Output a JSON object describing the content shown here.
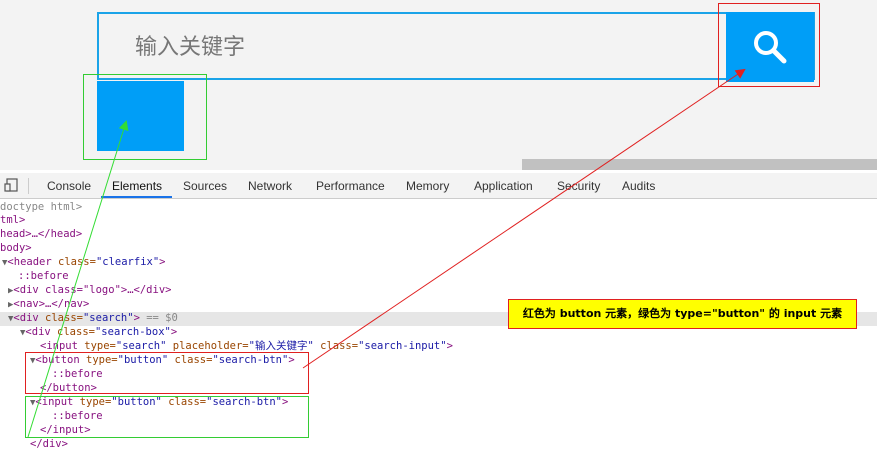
{
  "preview": {
    "search_placeholder": "输入关键字",
    "accent_color": "#009ef7",
    "icon": "search-icon"
  },
  "devtools": {
    "tabs": [
      "Console",
      "Elements",
      "Sources",
      "Network",
      "Performance",
      "Memory",
      "Application",
      "Security",
      "Audits"
    ],
    "active_tab": "Elements"
  },
  "dom": {
    "doctype": "doctype html>",
    "html_open": "tml>",
    "head": "head>…</head>",
    "body": "body>",
    "header_tag": "<header",
    "header_attr": " class=",
    "header_val": "\"clearfix\"",
    "header_close": ">",
    "before1": "::before",
    "logo": "<div class=\"logo\">…</div>",
    "nav": "<nav>…</nav>",
    "search_div_tag": "<div",
    "search_div_attr": " class=",
    "search_div_val": "\"search\"",
    "search_div_close": ">",
    "search_div_eq": " == $0",
    "search_box_tag": "<div",
    "search_box_attr": " class=",
    "search_box_val": "\"search-box\"",
    "search_box_close": ">",
    "input_tag": "<input",
    "input_type_attr": " type=",
    "input_type_val": "\"search\"",
    "input_ph_attr": " placeholder=",
    "input_ph_val": "\"输入关键字\"",
    "input_class_attr": " class=",
    "input_class_val": "\"search-input\"",
    "input_close": ">",
    "button_tag": "<button",
    "button_type_attr": " type=",
    "button_type_val": "\"button\"",
    "button_class_attr": " class=",
    "button_class_val": "\"search-btn\"",
    "button_close": ">",
    "before2": "::before",
    "button_end": "</button>",
    "input2_tag": "<input",
    "input2_type_attr": " type=",
    "input2_type_val": "\"button\"",
    "input2_class_attr": " class=",
    "input2_class_val": "\"search-btn\"",
    "input2_close": ">",
    "before3": "::before",
    "input2_end": "</input>",
    "div_end": "</div>"
  },
  "annotation": {
    "text": "红色为 button 元素，绿色为 type=\"button\" 的 input 元素"
  }
}
